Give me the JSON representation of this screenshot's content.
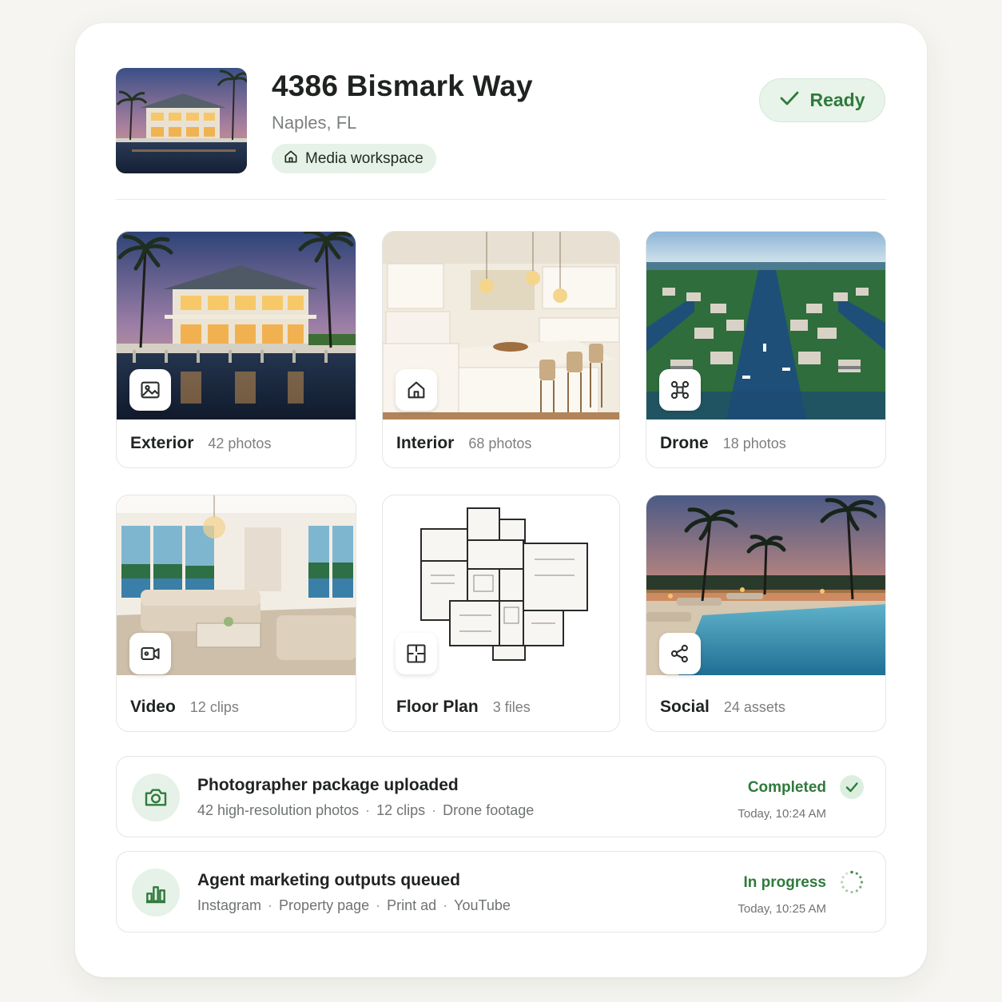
{
  "listing": {
    "address": "4386 Bismark Way",
    "city": "Naples, FL",
    "workspace_label": "Media workspace",
    "status": "Ready",
    "status_icon": "check-icon"
  },
  "categories": [
    {
      "name": "Exterior",
      "count": "42 photos",
      "icon": "image-icon"
    },
    {
      "name": "Interior",
      "count": "68 photos",
      "icon": "home-icon"
    },
    {
      "name": "Drone",
      "count": "18 photos",
      "icon": "drone-icon"
    },
    {
      "name": "Video",
      "count": "12 clips",
      "icon": "video-icon"
    },
    {
      "name": "Floor Plan",
      "count": "3 files",
      "icon": "floor-plan-icon"
    },
    {
      "name": "Social",
      "count": "24 assets",
      "icon": "share-icon"
    }
  ],
  "activity": [
    {
      "title": "Photographer package uploaded",
      "details": [
        "42 high-resolution photos",
        "12 clips",
        "Drone footage"
      ],
      "status": "Completed",
      "time": "Today, 10:24 AM",
      "icon": "camera-icon"
    },
    {
      "title": "Agent marketing outputs queued",
      "details": [
        "Instagram",
        "Property page",
        "Print ad",
        "YouTube"
      ],
      "status": "In progress",
      "time": "Today, 10:25 AM",
      "icon": "chart-icon"
    }
  ],
  "separator": "·",
  "colors": {
    "accent": "#2f7a3c",
    "accent_bg": "#e6f1e7",
    "background": "#f6f5f1"
  }
}
